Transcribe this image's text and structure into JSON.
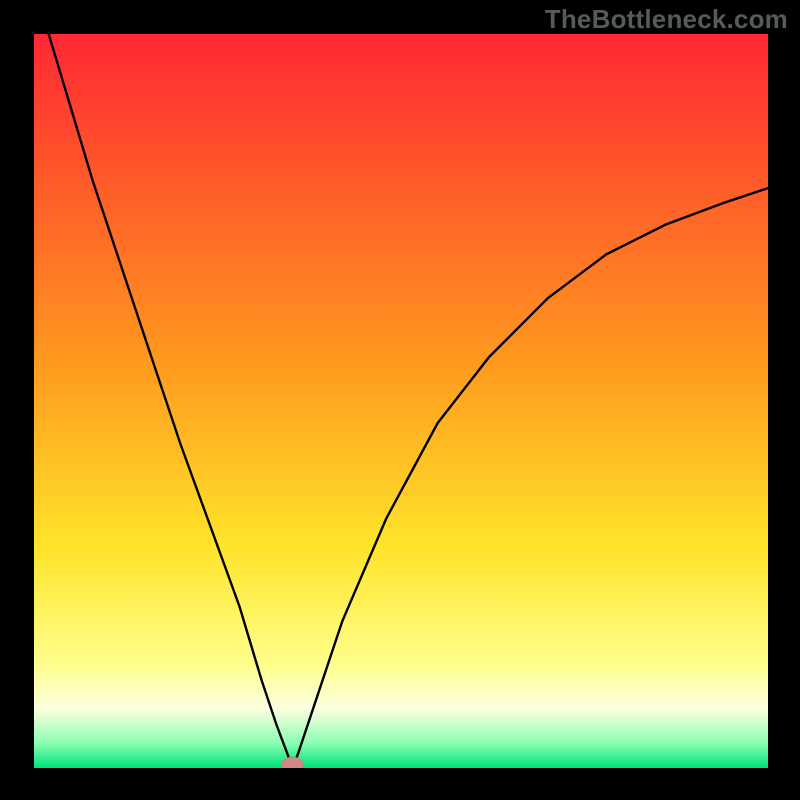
{
  "watermark": {
    "text": "TheBottleneck.com"
  },
  "chart_data": {
    "type": "line",
    "title": "",
    "xlabel": "",
    "ylabel": "",
    "xlim": [
      0,
      100
    ],
    "ylim": [
      0,
      100
    ],
    "grid": false,
    "legend": false,
    "background_gradient_stops": [
      {
        "offset": 0.0,
        "color": "#ff2733"
      },
      {
        "offset": 0.45,
        "color": "#ff9a1e"
      },
      {
        "offset": 0.7,
        "color": "#ffe42a"
      },
      {
        "offset": 0.86,
        "color": "#ffff8d"
      },
      {
        "offset": 0.92,
        "color": "#fbffe0"
      },
      {
        "offset": 0.965,
        "color": "#8dffb2"
      },
      {
        "offset": 1.0,
        "color": "#00e27b"
      }
    ],
    "series": [
      {
        "name": "bottleneck-curve",
        "x": [
          2,
          5,
          8,
          12,
          16,
          20,
          24,
          28,
          31,
          33,
          34.5,
          35.2,
          36,
          38,
          42,
          48,
          55,
          62,
          70,
          78,
          86,
          94,
          100
        ],
        "y": [
          100,
          90,
          80,
          68,
          56,
          44,
          33,
          22,
          12,
          6,
          2,
          0,
          2,
          8,
          20,
          34,
          47,
          56,
          64,
          70,
          74,
          77,
          79
        ]
      }
    ],
    "marker": {
      "x": 35.2,
      "y": 0,
      "shape": "ellipse",
      "color": "#cf8a85"
    }
  }
}
